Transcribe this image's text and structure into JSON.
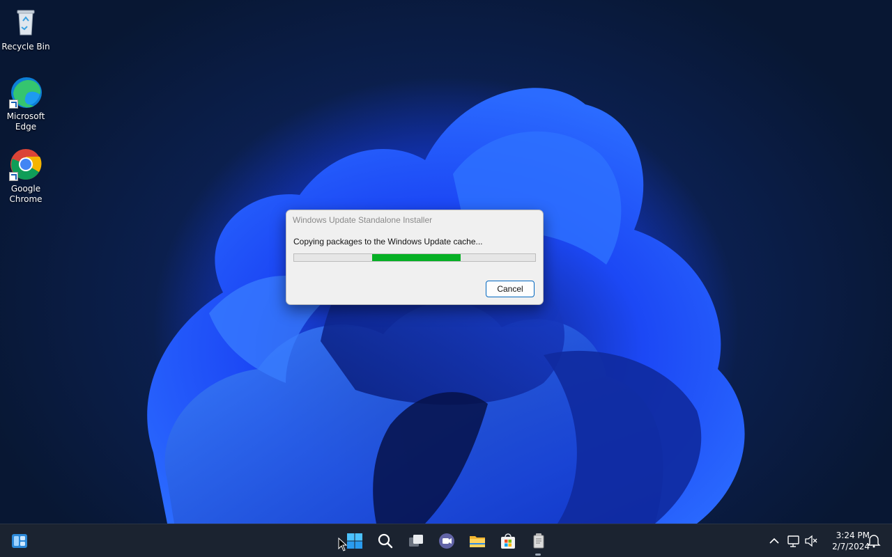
{
  "desktop": {
    "icons": [
      {
        "label": "Recycle Bin",
        "icon": "recycle-bin-icon"
      },
      {
        "label": "Microsoft Edge",
        "icon": "edge-icon"
      },
      {
        "label": "Google Chrome",
        "icon": "chrome-icon"
      }
    ]
  },
  "dialog": {
    "title": "Windows Update Standalone Installer",
    "message": "Copying packages to the Windows Update cache...",
    "progress": {
      "start_fraction": 0.325,
      "end_fraction": 0.69,
      "color": "#06b025"
    },
    "cancel_label": "Cancel"
  },
  "taskbar": {
    "left": [
      {
        "icon": "widgets-icon"
      }
    ],
    "center": [
      {
        "icon": "start-icon"
      },
      {
        "icon": "search-icon"
      },
      {
        "icon": "task-view-icon"
      },
      {
        "icon": "teams-chat-icon"
      },
      {
        "icon": "file-explorer-icon"
      },
      {
        "icon": "microsoft-store-icon"
      },
      {
        "icon": "installer-icon"
      }
    ],
    "tray": {
      "icons": [
        "chevron-up-icon",
        "network-icon",
        "volume-muted-icon",
        "notification-icon"
      ],
      "time": "3:24 PM",
      "date": "2/7/2024"
    }
  },
  "colors": {
    "accent": "#0067c0",
    "taskbar": "#1b2330",
    "wallpaper_blue": "#1d4fff"
  }
}
